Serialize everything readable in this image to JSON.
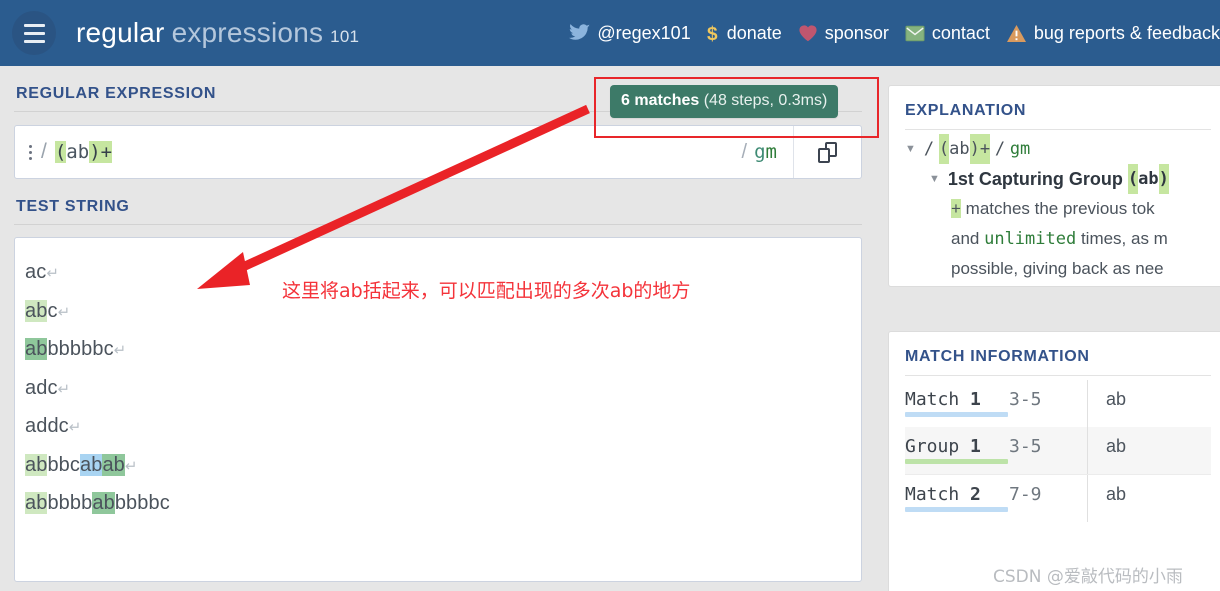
{
  "header": {
    "menu_icon": "hamburger-menu-icon",
    "brand_word1": "regular",
    "brand_word2": "expressions",
    "brand_suffix": "101",
    "links": [
      {
        "icon": "twitter-bird-icon",
        "label": "@regex101"
      },
      {
        "icon": "dollar-sign-icon",
        "label": "donate"
      },
      {
        "icon": "heart-icon",
        "label": "sponsor"
      },
      {
        "icon": "envelope-icon",
        "label": "contact"
      },
      {
        "icon": "warning-triangle-icon",
        "label": "bug reports & feedback"
      }
    ]
  },
  "regex_section": {
    "label": "REGULAR EXPRESSION",
    "kebab_icon": "kebab-menu-icon",
    "delimiter": "/",
    "pattern_tokens": [
      {
        "text": "(",
        "highlight": true
      },
      {
        "text": "ab",
        "highlight": false
      },
      {
        "text": ")+",
        "highlight": true
      }
    ],
    "pattern_full": "(ab)+",
    "flags_slash": "/",
    "flag_g": "g",
    "flag_m": "m",
    "flags": "gm",
    "copy_icon": "copy-icon"
  },
  "match_counter": {
    "matches_text": "6 matches",
    "details_text": " (48 steps, 0.3ms)",
    "match_count": 6,
    "steps": 48,
    "time": "0.3ms",
    "badge_color": "#3d7a68"
  },
  "test_section": {
    "label": "TEST STRING",
    "pilcrow": "↵",
    "lines": [
      {
        "segments": [
          {
            "text": "ac",
            "hl": "none"
          }
        ],
        "newline": true
      },
      {
        "segments": [
          {
            "text": "ab",
            "hl": "light"
          },
          {
            "text": "c",
            "hl": "none"
          }
        ],
        "newline": true
      },
      {
        "segments": [
          {
            "text": "ab",
            "hl": "dark"
          },
          {
            "text": "bbbbbc",
            "hl": "none"
          }
        ],
        "newline": true
      },
      {
        "segments": [
          {
            "text": "adc",
            "hl": "none"
          }
        ],
        "newline": true
      },
      {
        "segments": [
          {
            "text": "addc",
            "hl": "none"
          }
        ],
        "newline": true
      },
      {
        "segments": [
          {
            "text": "ab",
            "hl": "light"
          },
          {
            "text": "bbc",
            "hl": "none"
          },
          {
            "text": "ab",
            "hl": "blue"
          },
          {
            "text": "ab",
            "hl": "dark"
          }
        ],
        "newline": true
      },
      {
        "segments": [
          {
            "text": "ab",
            "hl": "light"
          },
          {
            "text": "bbbb",
            "hl": "none"
          },
          {
            "text": "ab",
            "hl": "dark"
          },
          {
            "text": "bbbbc",
            "hl": "none"
          }
        ],
        "newline": false
      }
    ]
  },
  "explanation": {
    "label": "EXPLANATION",
    "header_line": {
      "slash_left": "/",
      "tokens": [
        {
          "text": "(",
          "highlight": true
        },
        {
          "text": "ab",
          "highlight": false
        },
        {
          "text": ")+",
          "highlight": true
        }
      ],
      "slash_right": "/",
      "flags": "gm"
    },
    "group_line": {
      "title": "1st Capturing Group",
      "tokens": [
        {
          "text": "(",
          "highlight": true
        },
        {
          "text": "ab",
          "highlight": false
        },
        {
          "text": ")",
          "highlight": true
        }
      ]
    },
    "quantifier_lines": [
      {
        "token": "+",
        "text": " matches the previous tok"
      },
      {
        "prefix": "and ",
        "mono": "unlimited",
        "suffix": " times, as m"
      },
      {
        "text": "possible, giving back as nee"
      }
    ]
  },
  "match_information": {
    "label": "MATCH INFORMATION",
    "rows": [
      {
        "name": "Match",
        "index": "1",
        "range": "3-5",
        "value": "ab",
        "underline_color": "#bfdcf5",
        "alt": false
      },
      {
        "name": "Group",
        "index": "1",
        "range": "3-5",
        "value": "ab",
        "underline_color": "#bde3a8",
        "alt": true
      },
      {
        "name": "Match",
        "index": "2",
        "range": "7-9",
        "value": "ab",
        "underline_color": "#bfdcf5",
        "alt": false
      }
    ]
  },
  "annotation": {
    "note_text": "这里将ab括起来，可以匹配出现的多次ab的地方",
    "arrow_color": "#ea2327",
    "box_color": "#e8262a"
  },
  "watermark": {
    "text": "CSDN @爱敲代码的小雨"
  }
}
